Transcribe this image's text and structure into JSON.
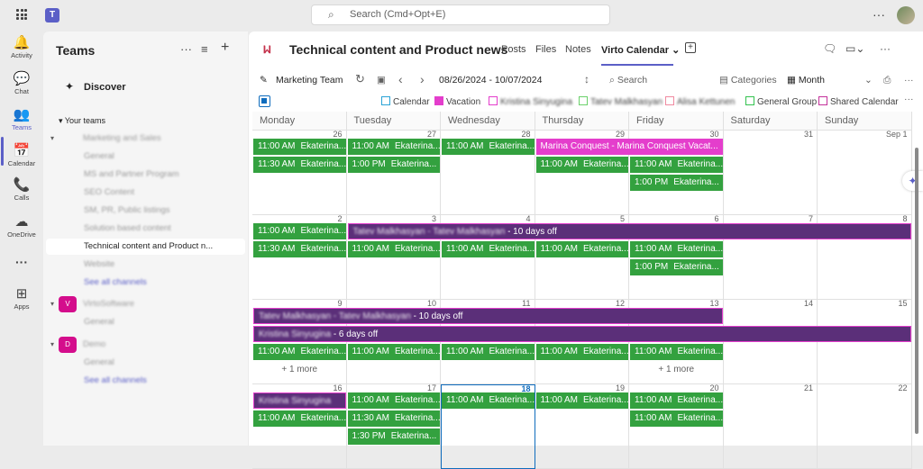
{
  "app": {
    "search_placeholder": "Search (Cmd+Opt+E)",
    "more": "···"
  },
  "rail": [
    {
      "label": "Activity",
      "icon": "bell-icon",
      "glyph": "🔔"
    },
    {
      "label": "Chat",
      "icon": "chat-icon",
      "glyph": "💬"
    },
    {
      "label": "Teams",
      "icon": "teams-icon",
      "glyph": "👥"
    },
    {
      "label": "Calendar",
      "icon": "calendar-icon",
      "glyph": "📅"
    },
    {
      "label": "Calls",
      "icon": "phone-icon",
      "glyph": "📞"
    },
    {
      "label": "OneDrive",
      "icon": "cloud-icon",
      "glyph": "☁"
    },
    {
      "label": "···",
      "icon": "more-icon",
      "glyph": ""
    },
    {
      "label": "Apps",
      "icon": "apps-icon",
      "glyph": "⊞"
    }
  ],
  "teams_panel": {
    "title": "Teams",
    "discover": "Discover",
    "your_teams": "Your teams",
    "teams": [
      {
        "name": "Marketing and Sales",
        "avatar": "",
        "color": "#c4314b",
        "channels": [
          "General",
          "MS and Partner Program",
          "SEO Content",
          "SM, PR, Public listings",
          "Solution based content",
          "Technical content and Product n...",
          "Website",
          "See all channels"
        ]
      },
      {
        "name": "VirtoSoftware",
        "avatar": "V",
        "color": "#d40d8c",
        "channels": [
          "General"
        ]
      },
      {
        "name": "Demo",
        "avatar": "D",
        "color": "#d40d8c",
        "channels": [
          "General",
          "See all channels"
        ]
      }
    ]
  },
  "header": {
    "title": "Technical content and Product news",
    "tabs": [
      "Posts",
      "Files",
      "Notes",
      "Virto Calendar"
    ],
    "add_tab": "+"
  },
  "toolbar": {
    "calendar_name": "Marketing Team",
    "date_range": "08/26/2024 - 10/07/2024",
    "search": "Search",
    "categories": "Categories",
    "view": "Month"
  },
  "legend": [
    {
      "label": "Calendar",
      "color": "#2aa3d6",
      "blur": false,
      "fill": false
    },
    {
      "label": "Vacation",
      "color": "#e43ecc",
      "blur": false,
      "fill": true
    },
    {
      "label": "Kristina Sinyugina",
      "color": "#e43ecc",
      "blur": true,
      "fill": false
    },
    {
      "label": "Tatev Malkhasyan",
      "color": "#6bd16b",
      "blur": true,
      "fill": false
    },
    {
      "label": "Alisa Kettunen",
      "color": "#f08aa0",
      "blur": true,
      "fill": false
    },
    {
      "label": "General Group",
      "color": "#33c24f",
      "blur": false,
      "fill": false
    },
    {
      "label": "Shared Calendar",
      "color": "#c4319b",
      "blur": false,
      "fill": false
    }
  ],
  "calendar": {
    "days": [
      "Monday",
      "Tuesday",
      "Wednesday",
      "Thursday",
      "Friday",
      "Saturday",
      "Sunday"
    ],
    "weeks": [
      {
        "dates": [
          "26",
          "27",
          "28",
          "29",
          "30",
          "31",
          "Sep 1"
        ]
      },
      {
        "dates": [
          "2",
          "3",
          "4",
          "5",
          "6",
          "7",
          "8"
        ]
      },
      {
        "dates": [
          "9",
          "10",
          "11",
          "12",
          "13",
          "14",
          "15"
        ]
      },
      {
        "dates": [
          "16",
          "17",
          "18",
          "19",
          "20",
          "21",
          "22"
        ]
      }
    ],
    "today_col": 2,
    "today_week": 3,
    "events": [
      {
        "w": 0,
        "c": 0,
        "span": 1,
        "row": 0,
        "color": "green",
        "time": "11:00 AM",
        "title": "Ekaterina..."
      },
      {
        "w": 0,
        "c": 1,
        "span": 1,
        "row": 0,
        "color": "green",
        "time": "11:00 AM",
        "title": "Ekaterina..."
      },
      {
        "w": 0,
        "c": 2,
        "span": 1,
        "row": 0,
        "color": "green",
        "time": "11:00 AM",
        "title": "Ekaterina..."
      },
      {
        "w": 0,
        "c": 3,
        "span": 2,
        "row": 0,
        "color": "pink",
        "time": "",
        "title": "Marina Conquest - Marina Conquest Vacat..."
      },
      {
        "w": 0,
        "c": 0,
        "span": 1,
        "row": 1,
        "color": "green",
        "time": "11:30 AM",
        "title": "Ekaterina..."
      },
      {
        "w": 0,
        "c": 1,
        "span": 1,
        "row": 1,
        "color": "green",
        "time": "1:00 PM",
        "title": "Ekaterina..."
      },
      {
        "w": 0,
        "c": 3,
        "span": 1,
        "row": 1,
        "color": "green",
        "time": "11:00 AM",
        "title": "Ekaterina..."
      },
      {
        "w": 0,
        "c": 4,
        "span": 1,
        "row": 1,
        "color": "green",
        "time": "11:00 AM",
        "title": "Ekaterina..."
      },
      {
        "w": 0,
        "c": 4,
        "span": 1,
        "row": 2,
        "color": "green",
        "time": "1:00 PM",
        "title": "Ekaterina..."
      },
      {
        "w": 1,
        "c": 0,
        "span": 1,
        "row": 0,
        "color": "green",
        "time": "11:00 AM",
        "title": "Ekaterina..."
      },
      {
        "w": 1,
        "c": 1,
        "span": 6,
        "row": 0,
        "color": "purple",
        "time": "",
        "blurred": "Tatev Malkhasyan - Tatev Malkhasyan",
        "title": " - 10 days off"
      },
      {
        "w": 1,
        "c": 0,
        "span": 1,
        "row": 1,
        "color": "green",
        "time": "11:30 AM",
        "title": "Ekaterina..."
      },
      {
        "w": 1,
        "c": 1,
        "span": 1,
        "row": 1,
        "color": "green",
        "time": "11:00 AM",
        "title": "Ekaterina..."
      },
      {
        "w": 1,
        "c": 2,
        "span": 1,
        "row": 1,
        "color": "green",
        "time": "11:00 AM",
        "title": "Ekaterina..."
      },
      {
        "w": 1,
        "c": 3,
        "span": 1,
        "row": 1,
        "color": "green",
        "time": "11:00 AM",
        "title": "Ekaterina..."
      },
      {
        "w": 1,
        "c": 4,
        "span": 1,
        "row": 1,
        "color": "green",
        "time": "11:00 AM",
        "title": "Ekaterina..."
      },
      {
        "w": 1,
        "c": 4,
        "span": 1,
        "row": 2,
        "color": "green",
        "time": "1:00 PM",
        "title": "Ekaterina..."
      },
      {
        "w": 2,
        "c": 0,
        "span": 5,
        "row": 0,
        "color": "purple",
        "time": "",
        "blurred": "Tatev Malkhasyan - Tatev Malkhasyan",
        "title": " - 10 days off"
      },
      {
        "w": 2,
        "c": 0,
        "span": 7,
        "row": 1,
        "color": "purple",
        "time": "",
        "blurred": "Kristina Sinyugina",
        "title": " - 6 days off"
      },
      {
        "w": 2,
        "c": 0,
        "span": 1,
        "row": 2,
        "color": "green",
        "time": "11:00 AM",
        "title": "Ekaterina..."
      },
      {
        "w": 2,
        "c": 1,
        "span": 1,
        "row": 2,
        "color": "green",
        "time": "11:00 AM",
        "title": "Ekaterina..."
      },
      {
        "w": 2,
        "c": 2,
        "span": 1,
        "row": 2,
        "color": "green",
        "time": "11:00 AM",
        "title": "Ekaterina..."
      },
      {
        "w": 2,
        "c": 3,
        "span": 1,
        "row": 2,
        "color": "green",
        "time": "11:00 AM",
        "title": "Ekaterina..."
      },
      {
        "w": 2,
        "c": 4,
        "span": 1,
        "row": 2,
        "color": "green",
        "time": "11:00 AM",
        "title": "Ekaterina..."
      },
      {
        "w": 3,
        "c": 0,
        "span": 1,
        "row": 0,
        "color": "purple",
        "time": "",
        "blurred": "Kristina Sinyugina",
        "title": ""
      },
      {
        "w": 3,
        "c": 1,
        "span": 1,
        "row": 0,
        "color": "green",
        "time": "11:00 AM",
        "title": "Ekaterina..."
      },
      {
        "w": 3,
        "c": 2,
        "span": 1,
        "row": 0,
        "color": "green",
        "time": "11:00 AM",
        "title": "Ekaterina..."
      },
      {
        "w": 3,
        "c": 3,
        "span": 1,
        "row": 0,
        "color": "green",
        "time": "11:00 AM",
        "title": "Ekaterina..."
      },
      {
        "w": 3,
        "c": 4,
        "span": 1,
        "row": 0,
        "color": "green",
        "time": "11:00 AM",
        "title": "Ekaterina..."
      },
      {
        "w": 3,
        "c": 0,
        "span": 1,
        "row": 1,
        "color": "green",
        "time": "11:00 AM",
        "title": "Ekaterina..."
      },
      {
        "w": 3,
        "c": 1,
        "span": 1,
        "row": 1,
        "color": "green",
        "time": "11:30 AM",
        "title": "Ekaterina..."
      },
      {
        "w": 3,
        "c": 4,
        "span": 1,
        "row": 1,
        "color": "green",
        "time": "11:00 AM",
        "title": "Ekaterina..."
      },
      {
        "w": 3,
        "c": 1,
        "span": 1,
        "row": 2,
        "color": "green",
        "time": "1:30 PM",
        "title": "Ekaterina..."
      }
    ],
    "more": [
      {
        "w": 2,
        "c": 0,
        "label": "+ 1 more"
      },
      {
        "w": 2,
        "c": 4,
        "label": "+ 1 more"
      }
    ]
  }
}
